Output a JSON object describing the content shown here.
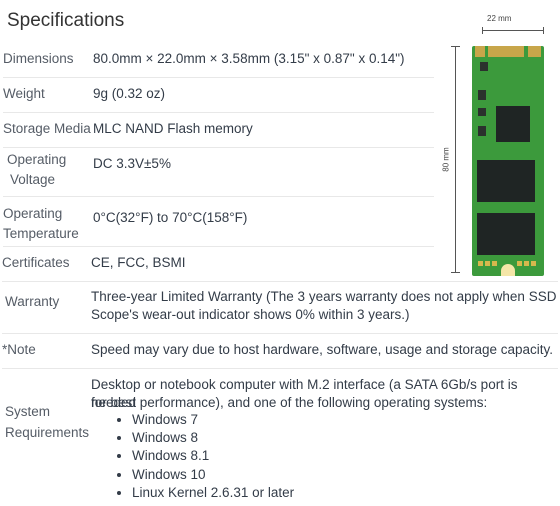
{
  "page": {
    "title": "Specifications"
  },
  "specs": [
    {
      "label": "Dimensions",
      "value": "80.0mm × 22.0mm × 3.58mm (3.15\" x 0.87\" x 0.14\")"
    },
    {
      "label": "Weight",
      "value": "9g (0.32 oz)"
    },
    {
      "label": "Storage Media",
      "value": "MLC NAND Flash memory"
    },
    {
      "label_lines": [
        "Operating",
        "Voltage"
      ],
      "value": "DC 3.3V±5%"
    },
    {
      "label_lines": [
        "Operating",
        "Temperature"
      ],
      "value": "0°C(32°F) to 70°C(158°F)"
    },
    {
      "label": "Certificates",
      "value": "CE, FCC, BSMI"
    },
    {
      "label": "Warranty",
      "value_lines": [
        "Three-year Limited Warranty (The 3 years warranty does not apply when SSD",
        "Scope's wear-out indicator shows 0% within 3 years.)"
      ]
    },
    {
      "label": "*Note",
      "value": "Speed may vary due to host hardware, software, usage and storage capacity."
    },
    {
      "label_lines": [
        "System",
        "Requirements"
      ],
      "value_lines": [
        "Desktop or notebook computer with M.2 interface (a SATA 6Gb/s port is needed",
        "for best performance), and one of the following operating systems:"
      ],
      "os_list": [
        "Windows 7",
        "Windows 8",
        "Windows 8.1",
        "Windows 10",
        "Linux Kernel 2.6.31 or later"
      ]
    }
  ],
  "figure": {
    "width_label": "22 mm",
    "length_label": "80 mm",
    "board_color": "#3c9a3c",
    "contact_color": "#c8a64a"
  }
}
